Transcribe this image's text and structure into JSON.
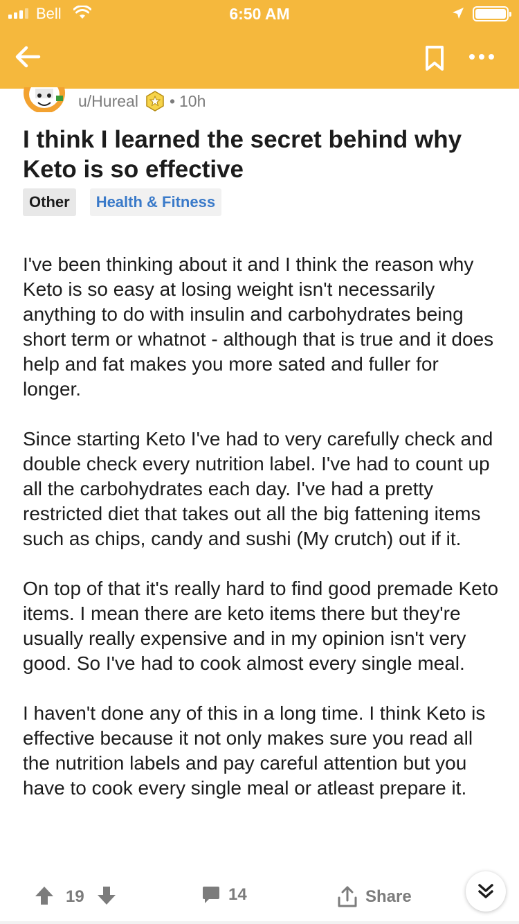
{
  "status_bar": {
    "carrier": "Bell",
    "time": "6:50 AM"
  },
  "header": {
    "background_color": "#f5b83d",
    "back_icon": "back-arrow-icon",
    "bookmark_icon": "bookmark-icon",
    "more_icon": "more-options-icon"
  },
  "post": {
    "author": "u/Hureal",
    "separator": "•",
    "age": "10h",
    "title": "I think I learned the secret behind why Keto is so effective",
    "flairs": [
      {
        "label": "Other"
      },
      {
        "label": "Health & Fitness",
        "color": "#3a7ac9"
      }
    ],
    "paragraphs": [
      "I've been thinking about it and I think the reason why Keto is so easy at losing weight isn't necessarily anything to do with insulin and carbohydrates being short term or whatnot - although that is true and it does help and fat makes you more sated and fuller for longer.",
      "Since starting Keto I've had to very carefully check and double check every nutrition label. I've had to count up all the carbohydrates each day. I've had a pretty restricted diet that takes out all the big fattening items such as chips, candy and sushi (My crutch) out if it.",
      "On top of that it's really hard to find good premade Keto items. I mean there are keto items there but they're usually really expensive and in my opinion isn't very good. So I've had to cook almost every single meal.",
      "I haven't done any of this in a long time. I think Keto is effective because it not only makes sure you read all the nutrition labels and pay careful attention but you have to cook every single meal or atleast prepare it."
    ]
  },
  "actions": {
    "score": "19",
    "comments": "14",
    "share_label": "Share",
    "icon_color": "#7c7c7c"
  }
}
